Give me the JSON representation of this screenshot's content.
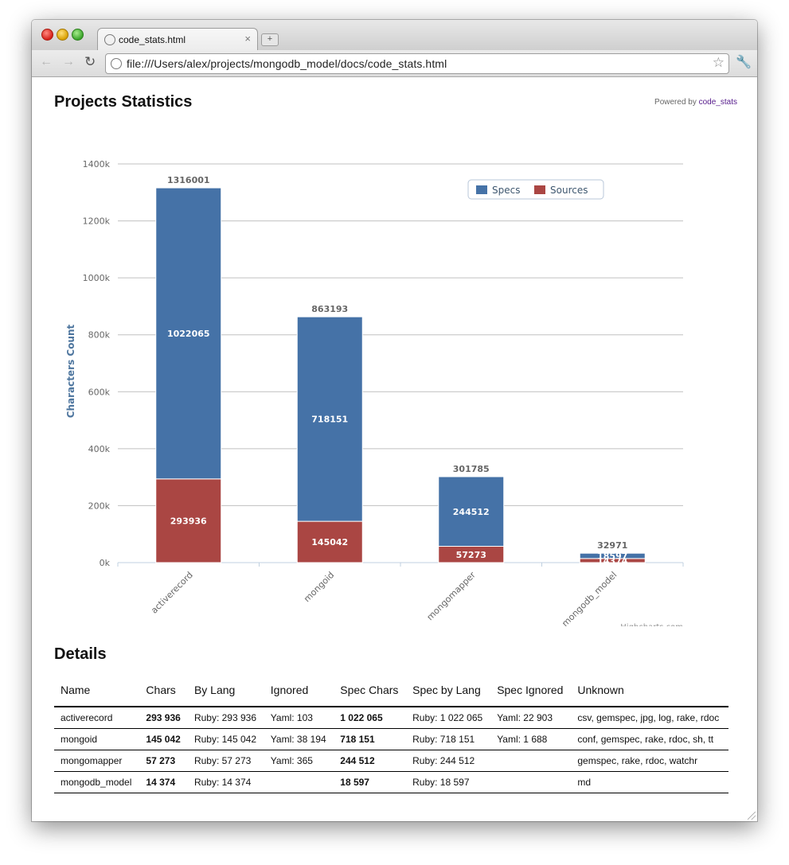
{
  "browser": {
    "tab_title": "code_stats.html",
    "tab_close": "×",
    "new_tab": "+",
    "url": "file:///Users/alex/projects/mongodb_model/docs/code_stats.html",
    "back": "←",
    "forward": "→",
    "reload": "↻",
    "star": "☆",
    "wrench": "🔧"
  },
  "page": {
    "title": "Projects Statistics",
    "powered_prefix": "Powered by ",
    "powered_link": "code_stats",
    "details_title": "Details"
  },
  "chart_data": {
    "type": "bar",
    "stacked": true,
    "categories": [
      "activerecord",
      "mongoid",
      "mongomapper",
      "mongodb_model"
    ],
    "series": [
      {
        "name": "Specs",
        "color": "#4572a7",
        "values": [
          1022065,
          718151,
          244512,
          18597
        ]
      },
      {
        "name": "Sources",
        "color": "#aa4643",
        "values": [
          293936,
          145042,
          57273,
          14374
        ]
      }
    ],
    "totals": [
      1316001,
      863193,
      301785,
      32971
    ],
    "ylabel": "Characters Count",
    "yticks": [
      "0k",
      "200k",
      "400k",
      "600k",
      "800k",
      "1000k",
      "1200k",
      "1400k"
    ],
    "ylim": [
      0,
      1400000
    ],
    "grid": true,
    "legend_position": "top-right",
    "credits": "Highcharts.com"
  },
  "table": {
    "headers": [
      "Name",
      "Chars",
      "By Lang",
      "Ignored",
      "Spec Chars",
      "Spec by Lang",
      "Spec Ignored",
      "Unknown"
    ],
    "rows": [
      [
        "activerecord",
        "293 936",
        "Ruby: 293 936",
        "Yaml: 103",
        "1 022 065",
        "Ruby: 1 022 065",
        "Yaml: 22 903",
        "csv, gemspec, jpg, log, rake, rdoc"
      ],
      [
        "mongoid",
        "145 042",
        "Ruby: 145 042",
        "Yaml: 38 194",
        "718 151",
        "Ruby: 718 151",
        "Yaml: 1 688",
        "conf, gemspec, rake, rdoc, sh, tt"
      ],
      [
        "mongomapper",
        "57 273",
        "Ruby: 57 273",
        "Yaml: 365",
        "244 512",
        "Ruby: 244 512",
        "",
        "gemspec, rake, rdoc, watchr"
      ],
      [
        "mongodb_model",
        "14 374",
        "Ruby: 14 374",
        "",
        "18 597",
        "Ruby: 18 597",
        "",
        "md"
      ]
    ]
  }
}
